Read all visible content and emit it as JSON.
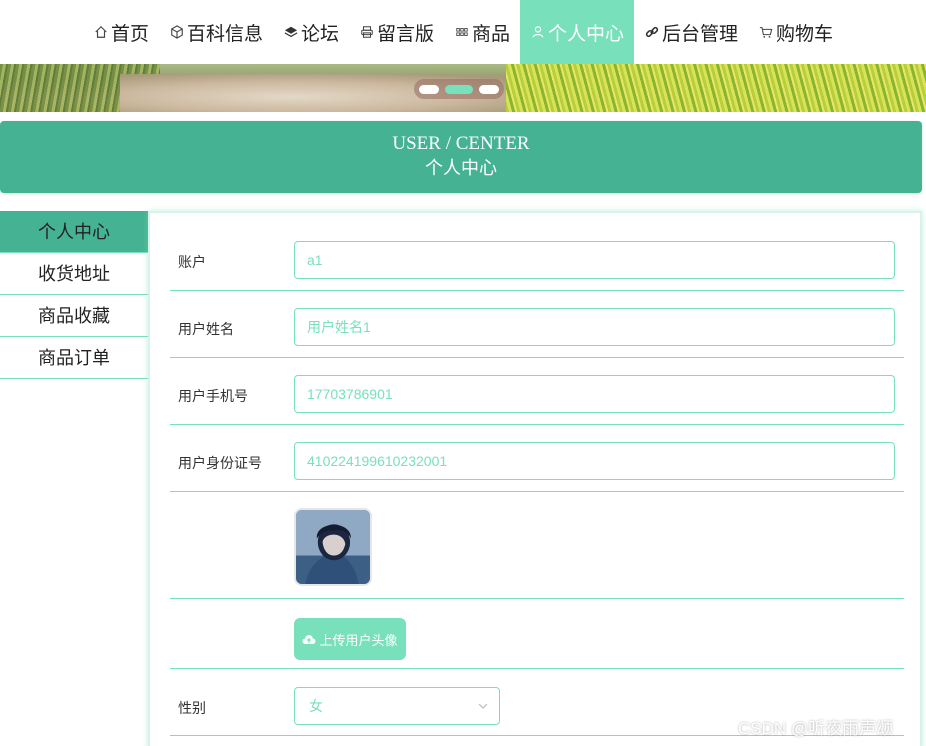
{
  "nav": {
    "items": [
      {
        "label": "首页",
        "icon": "home-icon"
      },
      {
        "label": "百科信息",
        "icon": "cube-icon"
      },
      {
        "label": "论坛",
        "icon": "layers-icon"
      },
      {
        "label": "留言版",
        "icon": "printer-icon"
      },
      {
        "label": "商品",
        "icon": "grid-icon"
      },
      {
        "label": "个人中心",
        "icon": "user-icon",
        "active": true
      },
      {
        "label": "后台管理",
        "icon": "link-icon"
      },
      {
        "label": "购物车",
        "icon": "cart-icon"
      }
    ]
  },
  "carousel": {
    "slides": 3,
    "active_index": 1
  },
  "header": {
    "title_en": "USER / CENTER",
    "title_cn": "个人中心"
  },
  "sidebar": {
    "items": [
      {
        "label": "个人中心",
        "active": true
      },
      {
        "label": "收货地址"
      },
      {
        "label": "商品收藏"
      },
      {
        "label": "商品订单"
      }
    ]
  },
  "form": {
    "account": {
      "label": "账户",
      "value": "a1"
    },
    "name": {
      "label": "用户姓名",
      "value": "用户姓名1"
    },
    "phone": {
      "label": "用户手机号",
      "value": "17703786901"
    },
    "id_card": {
      "label": "用户身份证号",
      "value": "410224199610232001"
    },
    "upload_label": "上传用户头像",
    "gender": {
      "label": "性别",
      "value": "女"
    }
  },
  "watermark": "CSDN @听夜雨声颂",
  "colors": {
    "accent": "#78e0bb",
    "header": "#45b393"
  }
}
